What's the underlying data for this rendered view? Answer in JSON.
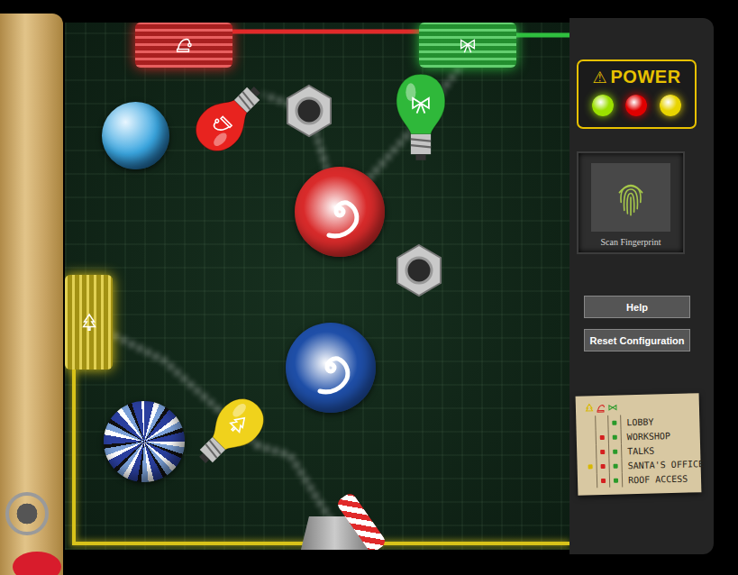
{
  "board": {
    "pieces": [
      {
        "kind": "socket",
        "color": "#e02a2a"
      },
      {
        "kind": "socket",
        "color": "#2fbf3f"
      },
      {
        "kind": "socket",
        "color": "#d8c21a"
      },
      {
        "kind": "bulb",
        "color": "#e8231f"
      },
      {
        "kind": "bulb",
        "color": "#2fb83a"
      },
      {
        "kind": "bulb",
        "color": "#f0d21c"
      },
      {
        "kind": "nut",
        "color": "#c9c9c9"
      },
      {
        "kind": "nut",
        "color": "#c9c9c9"
      },
      {
        "kind": "marble",
        "color": "#3aa6e0"
      },
      {
        "kind": "striped-marble",
        "color": "#2a3f9e"
      },
      {
        "kind": "portal",
        "color": "#d92b2b"
      },
      {
        "kind": "portal",
        "color": "#1f4fa8"
      },
      {
        "kind": "emitter",
        "color": "#b5b5b5"
      },
      {
        "kind": "cane",
        "color": "#e02a2a"
      }
    ]
  },
  "power": {
    "icon": "⚠",
    "label": "POWER",
    "lights": [
      {
        "color": "#9be000",
        "on": true
      },
      {
        "color": "#e00000",
        "on": true
      },
      {
        "color": "#e8d400",
        "on": true
      }
    ]
  },
  "scanner": {
    "label": "Scan Fingerprint"
  },
  "buttons": [
    "Help",
    "Reset Configuration"
  ],
  "note": {
    "columns": [
      {
        "kind": "tree",
        "color": "#d8b800"
      },
      {
        "kind": "hat",
        "color": "#d42020"
      },
      {
        "kind": "bow",
        "color": "#2a9a2a"
      }
    ],
    "rows": [
      {
        "label": "LOBBY",
        "marks": [
          false,
          false,
          true
        ]
      },
      {
        "label": "WORKSHOP",
        "marks": [
          false,
          true,
          true
        ]
      },
      {
        "label": "TALKS",
        "marks": [
          false,
          true,
          true
        ]
      },
      {
        "label": "SANTA'S OFFICE",
        "marks": [
          true,
          true,
          true
        ]
      },
      {
        "label": "ROOF ACCESS",
        "marks": [
          false,
          true,
          true
        ]
      }
    ]
  }
}
